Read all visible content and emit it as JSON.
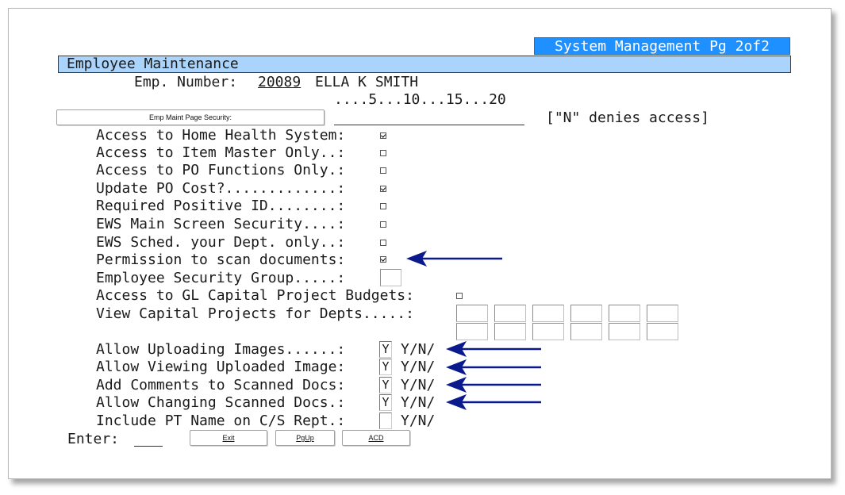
{
  "header": {
    "system_title": "System Management Pg 2of2",
    "screen_title": "Employee Maintenance"
  },
  "employee": {
    "number_label": "Emp. Number:",
    "number": "20089",
    "name": "ELLA K SMITH"
  },
  "ruler": "....5...10...15...20",
  "page_security": {
    "button_label": "Emp Maint Page Security:",
    "value": "",
    "hint": "[\"N\" denies access]"
  },
  "checkbox_fields": [
    {
      "label": "Access to Home Health System:",
      "checked": true
    },
    {
      "label": "Access to Item Master Only..:",
      "checked": false
    },
    {
      "label": "Access to PO Functions Only.:",
      "checked": false
    },
    {
      "label": "Update PO Cost?.............:",
      "checked": true
    },
    {
      "label": "Required Positive ID........:",
      "checked": false
    },
    {
      "label": "EWS Main Screen Security....:",
      "checked": false
    },
    {
      "label": "EWS Sched. your Dept. only..:",
      "checked": false
    },
    {
      "label": "Permission to scan documents:",
      "checked": true
    }
  ],
  "security_group": {
    "label": "Employee Security Group.....:",
    "value": ""
  },
  "gl_budgets": {
    "label": "Access to GL Capital Project Budgets:",
    "checked": false
  },
  "capital_depts": {
    "label": "View Capital Projects for Depts.....:",
    "values": [
      "",
      "",
      "",
      "",
      "",
      "",
      "",
      "",
      "",
      "",
      "",
      ""
    ]
  },
  "yn_fields": [
    {
      "label": "Allow Uploading Images......:",
      "value": "Y",
      "suffix": "Y/N/"
    },
    {
      "label": "Allow Viewing Uploaded Image:",
      "value": "Y",
      "suffix": "Y/N/"
    },
    {
      "label": "Add Comments to Scanned Docs:",
      "value": "Y",
      "suffix": "Y/N/"
    },
    {
      "label": "Allow Changing Scanned Docs.:",
      "value": "Y",
      "suffix": "Y/N/"
    },
    {
      "label": "Include PT Name on C/S Rept.:",
      "value": "",
      "suffix": "Y/N/"
    }
  ],
  "footer": {
    "enter_label": "Enter:",
    "enter_value": "",
    "buttons": {
      "exit": "Exit",
      "pgup": "PgUp",
      "acd": "ACD"
    }
  },
  "colors": {
    "system_bar": "#1e90ff",
    "title_bar": "#aad4fb",
    "arrow": "#0a1a8c"
  }
}
